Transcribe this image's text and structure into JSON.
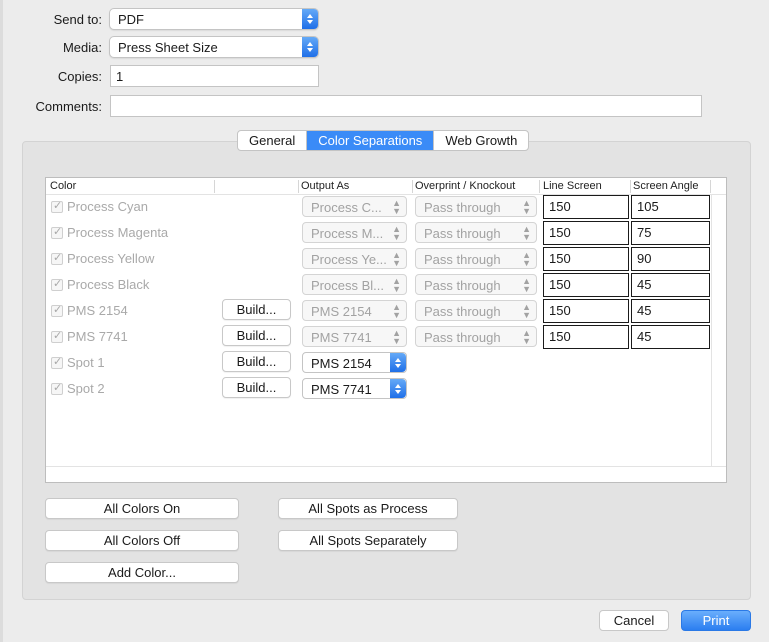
{
  "form": {
    "send_to_label": "Send to:",
    "send_to_value": "PDF",
    "media_label": "Media:",
    "media_value": "Press Sheet Size",
    "copies_label": "Copies:",
    "copies_value": "1",
    "comments_label": "Comments:",
    "comments_value": ""
  },
  "tabs": [
    {
      "label": "General",
      "selected": false
    },
    {
      "label": "Color Separations",
      "selected": true
    },
    {
      "label": "Web Growth",
      "selected": false
    }
  ],
  "table": {
    "headers": {
      "color": "Color",
      "output_as": "Output As",
      "overprint": "Overprint / Knockout",
      "line_screen": "Line Screen",
      "screen_angle": "Screen Angle"
    },
    "rows": [
      {
        "name": "Process Cyan",
        "checked": true,
        "build": "",
        "output": "Process C...",
        "output_enabled": false,
        "overprint": "Pass through",
        "line_screen": "150",
        "angle": "105"
      },
      {
        "name": "Process Magenta",
        "checked": true,
        "build": "",
        "output": "Process M...",
        "output_enabled": false,
        "overprint": "Pass through",
        "line_screen": "150",
        "angle": "75"
      },
      {
        "name": "Process Yellow",
        "checked": true,
        "build": "",
        "output": "Process Ye...",
        "output_enabled": false,
        "overprint": "Pass through",
        "line_screen": "150",
        "angle": "90"
      },
      {
        "name": "Process Black",
        "checked": true,
        "build": "",
        "output": "Process Bl...",
        "output_enabled": false,
        "overprint": "Pass through",
        "line_screen": "150",
        "angle": "45"
      },
      {
        "name": "PMS 2154",
        "checked": true,
        "build": "Build...",
        "output": "PMS 2154",
        "output_enabled": false,
        "overprint": "Pass through",
        "line_screen": "150",
        "angle": "45"
      },
      {
        "name": "PMS 7741",
        "checked": true,
        "build": "Build...",
        "output": "PMS 7741",
        "output_enabled": false,
        "overprint": "Pass through",
        "line_screen": "150",
        "angle": "45"
      },
      {
        "name": "Spot 1",
        "checked": true,
        "build": "Build...",
        "output": "PMS 2154",
        "output_enabled": true,
        "overprint": "",
        "line_screen": "",
        "angle": ""
      },
      {
        "name": "Spot 2",
        "checked": true,
        "build": "Build...",
        "output": "PMS 7741",
        "output_enabled": true,
        "overprint": "",
        "line_screen": "",
        "angle": ""
      }
    ]
  },
  "buttons": {
    "all_colors_on": "All Colors On",
    "all_colors_off": "All Colors Off",
    "add_color": "Add Color...",
    "all_spots_process": "All Spots as Process",
    "all_spots_separately": "All Spots Separately",
    "cancel": "Cancel",
    "print": "Print"
  },
  "colors": {
    "accent": "#3a8bf7",
    "print_button": "#3b8cf3"
  }
}
